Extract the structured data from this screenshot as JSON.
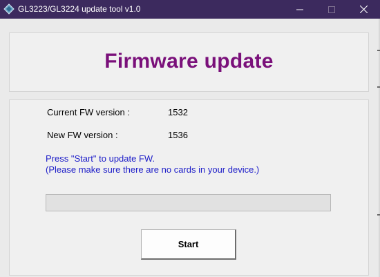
{
  "window": {
    "title": "GL3223/GL3224 update tool v1.0",
    "titlebar_color": "#3c2a5e",
    "icons": [
      "app-diamond-icon",
      "minimize-icon",
      "maximize-icon",
      "close-icon"
    ]
  },
  "header": {
    "title": "Firmware update",
    "title_color": "#7a107a"
  },
  "info": {
    "current_label": "Current FW version :",
    "current_value": "1532",
    "new_label": "New FW version :",
    "new_value": "1536"
  },
  "instructions": {
    "line1": "Press \"Start\" to update FW.",
    "line2": "(Please make sure there are no cards in your device.)",
    "color": "#1c1cc8"
  },
  "progress": {
    "value": 0
  },
  "actions": {
    "start_label": "Start"
  }
}
